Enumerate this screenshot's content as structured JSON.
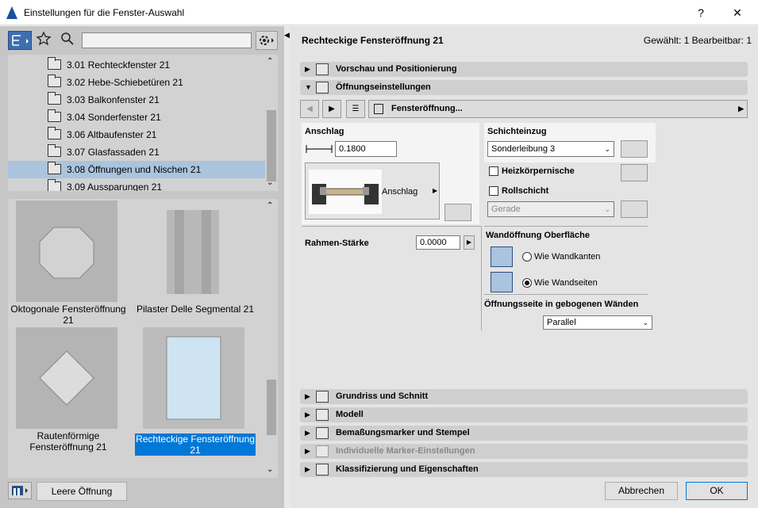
{
  "window": {
    "title": "Einstellungen für die Fenster-Auswahl",
    "help": "?",
    "close": "✕"
  },
  "left": {
    "search_placeholder": "",
    "tree": [
      {
        "label": "3.01 Rechteckfenster 21",
        "selected": false
      },
      {
        "label": "3.02 Hebe-Schiebetüren 21",
        "selected": false
      },
      {
        "label": "3.03 Balkonfenster 21",
        "selected": false
      },
      {
        "label": "3.04 Sonderfenster 21",
        "selected": false
      },
      {
        "label": "3.06 Altbaufenster 21",
        "selected": false
      },
      {
        "label": "3.07 Glasfassaden 21",
        "selected": false
      },
      {
        "label": "3.08 Öffnungen und Nischen 21",
        "selected": true
      },
      {
        "label": "3.09 Aussparungen 21",
        "selected": false
      }
    ],
    "thumbs": [
      {
        "caption": "Oktogonale Fensteröffnung 21",
        "selected": false
      },
      {
        "caption": "Pilaster Delle Segmental 21",
        "selected": false
      },
      {
        "caption": "Rautenförmige Fensteröffnung 21",
        "selected": false
      },
      {
        "caption": "Rechteckige Fensteröffnung 21",
        "selected": true
      }
    ],
    "empty_button": "Leere Öffnung"
  },
  "header": {
    "title": "Rechteckige Fensteröffnung 21",
    "selection": "Gewählt: 1 Bearbeitbar: 1"
  },
  "sections_top": [
    {
      "label": "Vorschau und Positionierung",
      "open": false
    },
    {
      "label": "Öffnungseinstellungen",
      "open": true
    }
  ],
  "nav": {
    "page_label": "Fensteröffnung..."
  },
  "anschlag": {
    "title": "Anschlag",
    "value": "0.1800",
    "preview_label": "Anschlag"
  },
  "schichteinzug": {
    "title": "Schichteinzug",
    "selected": "Sonderleibung 3"
  },
  "heizkoerper": {
    "label": "Heizkörpernische",
    "checked": false
  },
  "rollschicht": {
    "label": "Rollschicht",
    "checked": false,
    "combo": "Gerade"
  },
  "rahmen": {
    "label": "Rahmen-Stärke",
    "value": "0.0000"
  },
  "wandoeffnung": {
    "title": "Wandöffnung Oberfläche",
    "options": [
      {
        "label": "Wie Wandkanten",
        "selected": false
      },
      {
        "label": "Wie Wandseiten",
        "selected": true
      }
    ]
  },
  "gebogen": {
    "title": "Öffnungsseite in gebogenen Wänden",
    "selected": "Parallel"
  },
  "sections_bottom": [
    {
      "label": "Grundriss und Schnitt",
      "disabled": false
    },
    {
      "label": "Modell",
      "disabled": false
    },
    {
      "label": "Bemaßungsmarker und Stempel",
      "disabled": false
    },
    {
      "label": "Individuelle Marker-Einstellungen",
      "disabled": true
    },
    {
      "label": "Klassifizierung und Eigenschaften",
      "disabled": false
    }
  ],
  "buttons": {
    "cancel": "Abbrechen",
    "ok": "OK"
  },
  "colors": {
    "selection": "#0078d7",
    "tree_selection": "#aac4dd"
  }
}
